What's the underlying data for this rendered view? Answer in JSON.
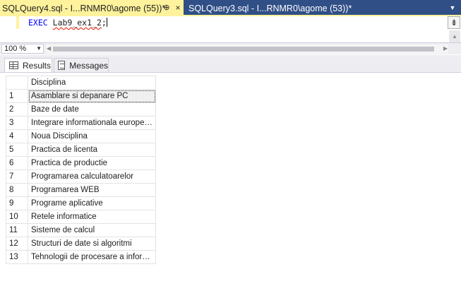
{
  "tabs": {
    "active_label": "SQLQuery4.sql - I...RNMR0\\agome (55))*",
    "pin_glyph": "⊕",
    "close_glyph": "×",
    "inactive_label": "SQLQuery3.sql - I...RNMR0\\agome (53))*",
    "dropdown_glyph": "▼"
  },
  "editor": {
    "keyword": "EXEC",
    "procedure": "Lab9_ex1_2",
    "terminator": ";",
    "splitter_glyph": "⇟"
  },
  "zoom": {
    "value": "100 %",
    "arrow": "▼"
  },
  "results_tabs": {
    "results_label": "Results",
    "messages_label": "Messages"
  },
  "grid": {
    "columns": [
      "",
      "Disciplina"
    ],
    "rows": [
      {
        "n": "1",
        "disciplina": "Asamblare si depanare PC"
      },
      {
        "n": "2",
        "disciplina": "Baze de date"
      },
      {
        "n": "3",
        "disciplina": "Integrare informationala europeana"
      },
      {
        "n": "4",
        "disciplina": "Noua Disciplina"
      },
      {
        "n": "5",
        "disciplina": "Practica de licenta"
      },
      {
        "n": "6",
        "disciplina": "Practica de productie"
      },
      {
        "n": "7",
        "disciplina": "Programarea calculatoarelor"
      },
      {
        "n": "8",
        "disciplina": "Programarea WEB"
      },
      {
        "n": "9",
        "disciplina": "Programe aplicative"
      },
      {
        "n": "10",
        "disciplina": "Retele informatice"
      },
      {
        "n": "11",
        "disciplina": "Sisteme de calcul"
      },
      {
        "n": "12",
        "disciplina": "Structuri de date si algoritmi"
      },
      {
        "n": "13",
        "disciplina": "Tehnologii de procesare a inform..."
      }
    ]
  },
  "colors": {
    "tab_active_bg": "#fff29d",
    "tab_strip_bg": "#304f86",
    "keyword": "#0000ff"
  }
}
